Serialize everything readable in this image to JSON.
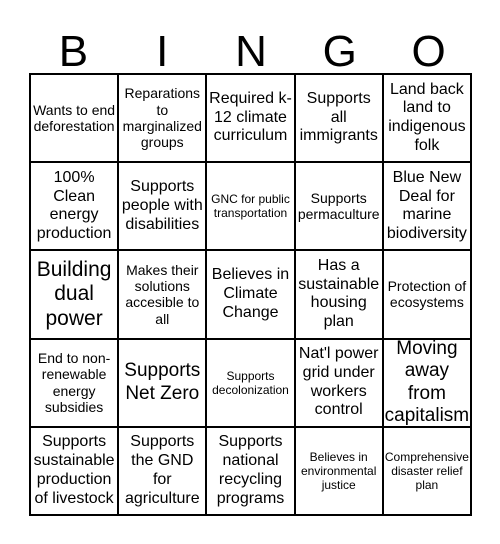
{
  "header": [
    "B",
    "I",
    "N",
    "G",
    "O"
  ],
  "cells": [
    "Wants to end deforestation",
    "Reparations to marginalized groups",
    "Required k-12 climate curriculum",
    "Supports all immigrants",
    "Land back land to indigenous folk",
    "100% Clean energy production",
    "Supports people with disabilities",
    "GNC for public transportation",
    "Supports permaculture",
    "Blue New Deal for marine biodiversity",
    "Building dual power",
    "Makes their solutions accesible to all",
    "Believes in Climate Change",
    "Has a sustainable housing plan",
    "Protection of ecosystems",
    "End to non-renewable energy subsidies",
    "Supports Net Zero",
    "Supports decolonization",
    "Nat'l power grid under workers control",
    "Moving away from capitalism",
    "Supports sustainable production of livestock",
    "Supports the GND for agriculture",
    "Supports national recycling programs",
    "Believes in environmental justice",
    "Comprehensive disaster relief plan"
  ]
}
